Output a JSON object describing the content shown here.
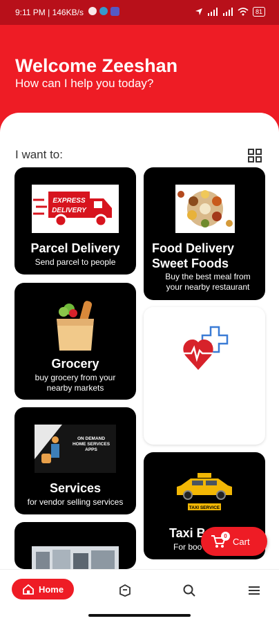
{
  "status_bar": {
    "time_and_speed": "9:11 PM | 146KB/s",
    "battery": "81"
  },
  "header": {
    "title": "Welcome Zeeshan",
    "subtitle": "How can I help you today?"
  },
  "section_label": "I want to:",
  "cards": {
    "parcel": {
      "title": "Parcel Delivery",
      "sub": "Send parcel to people",
      "image_text_1": "EXPRESS",
      "image_text_2": "DELIVERY"
    },
    "food": {
      "title_1": "Food Delivery",
      "title_2": "Sweet Foods",
      "sub_1": "Buy the best meal from",
      "sub_2": "your nearby restaurant"
    },
    "grocery": {
      "title": "Grocery",
      "sub_1": "buy grocery from your",
      "sub_2": "nearby markets"
    },
    "services": {
      "title": "Services",
      "sub": "for vendor selling services",
      "image_text_1": "ON DEMAND",
      "image_text_2": "HOME SERVICES",
      "image_text_3": "APPS"
    },
    "taxi": {
      "title": "Taxi B",
      "sub": "For boo",
      "image_text": "TAXI SERVICE"
    }
  },
  "cart": {
    "label": "Cart",
    "count": "0"
  },
  "nav": {
    "home_label": "Home"
  },
  "colors": {
    "brand_red": "#ee1c25",
    "card_black": "#000000"
  }
}
